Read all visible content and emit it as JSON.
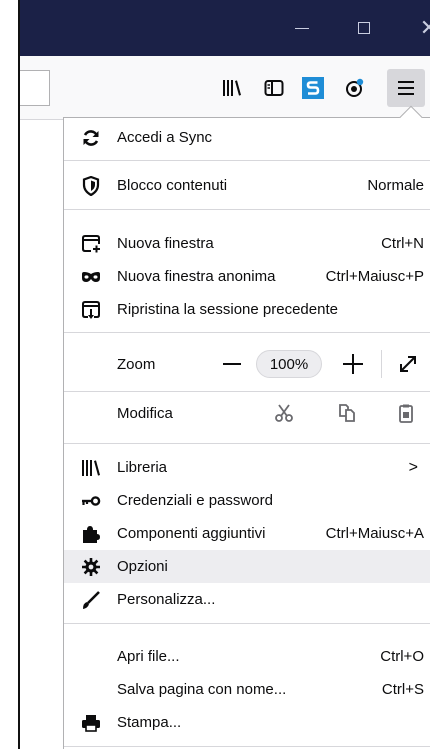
{
  "window": {
    "minimize_label": "—",
    "maximize_label": "",
    "close_label": "✕"
  },
  "toolbar": {
    "icons": [
      "library-icon",
      "sidebar-icon",
      "s-extension-icon",
      "pocket-icon",
      "hamburger-menu-icon"
    ]
  },
  "menu": {
    "sync": {
      "label": "Accedi a Sync"
    },
    "content_blocking": {
      "label": "Blocco contenuti",
      "value": "Normale"
    },
    "new_window": {
      "label": "Nuova finestra",
      "shortcut": "Ctrl+N"
    },
    "new_private": {
      "label": "Nuova finestra anonima",
      "shortcut": "Ctrl+Maiusc+P"
    },
    "restore_session": {
      "label": "Ripristina la sessione precedente"
    },
    "zoom": {
      "label": "Zoom",
      "value": "100%"
    },
    "edit": {
      "label": "Modifica"
    },
    "library": {
      "label": "Libreria",
      "arrow": ">"
    },
    "logins": {
      "label": "Credenziali e password"
    },
    "addons": {
      "label": "Componenti aggiuntivi",
      "shortcut": "Ctrl+Maiusc+A"
    },
    "options": {
      "label": "Opzioni"
    },
    "customize": {
      "label": "Personalizza..."
    },
    "open_file": {
      "label": "Apri file...",
      "shortcut": "Ctrl+O"
    },
    "save_page": {
      "label": "Salva pagina con nome...",
      "shortcut": "Ctrl+S"
    },
    "print": {
      "label": "Stampa..."
    }
  },
  "colors": {
    "titlebar": "#1b2147",
    "highlight": "#ededf0",
    "s_extension": "#1f8dd6"
  }
}
